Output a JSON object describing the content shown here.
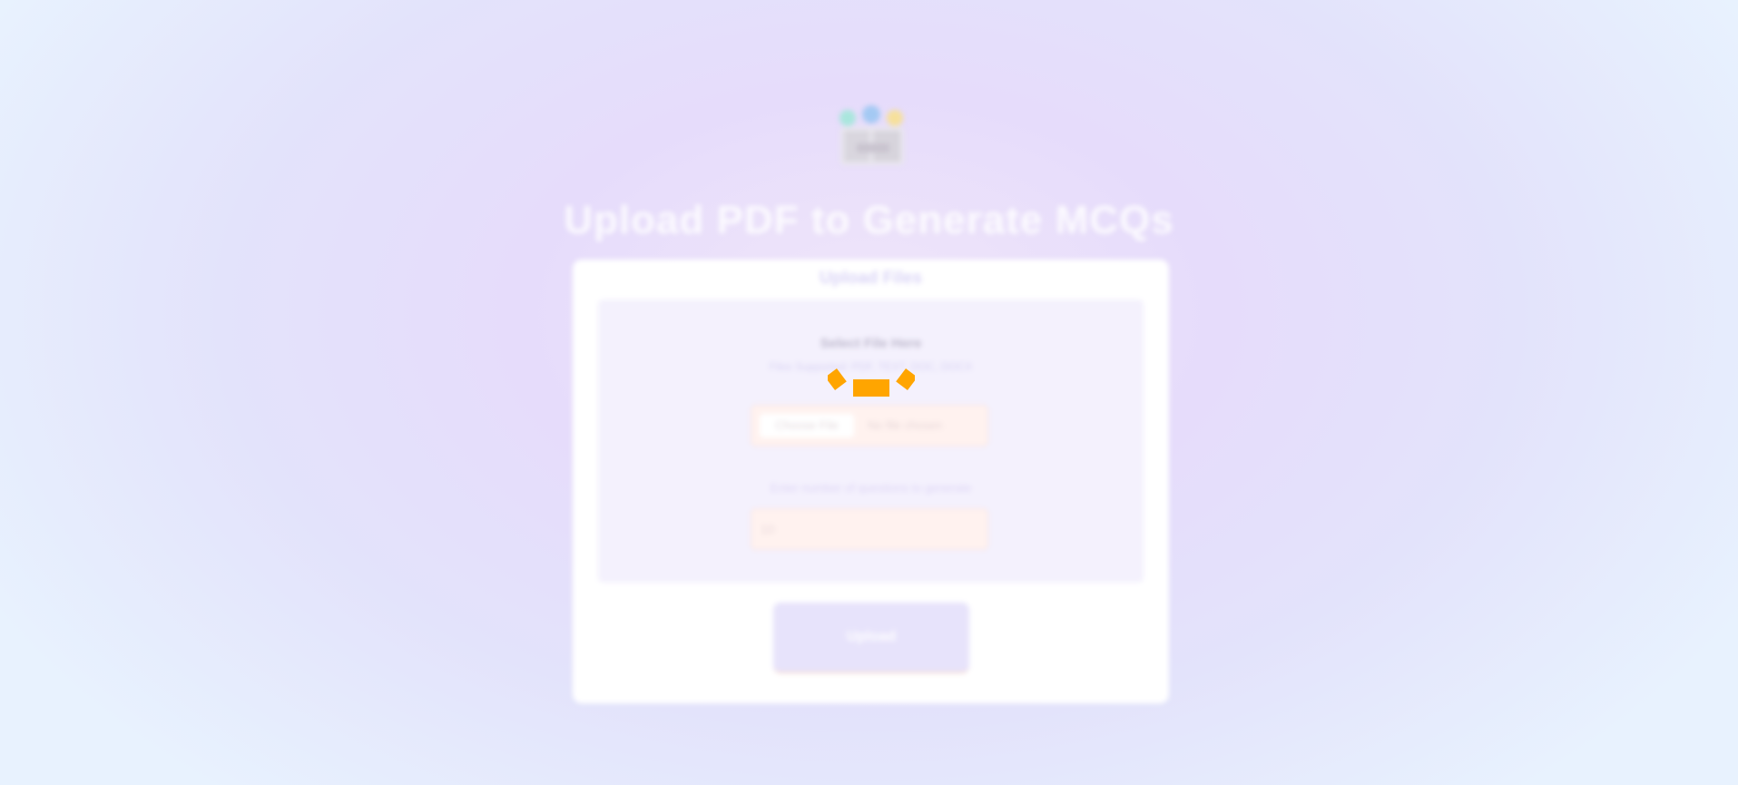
{
  "header": {
    "title": "Upload PDF to Generate MCQs",
    "logo_icon": "books-with-colored-circles-icon"
  },
  "card": {
    "title": "Upload Files",
    "select_title": "Select File Here",
    "select_subtitle": "Files Supported: PDF, TEXT, DOC, DOCX",
    "choose_file_label": "Choose File",
    "no_file_label": "No file chosen",
    "num_label": "Enter number of questions to generate",
    "num_value": "10",
    "upload_label": "Upload"
  },
  "loading": {
    "icon": "loading-spinner-icon",
    "color": "#ffa500"
  },
  "colors": {
    "accent": "#ffa500",
    "card_bg": "#ffffff",
    "panel_bg": "#f4f1fd"
  }
}
